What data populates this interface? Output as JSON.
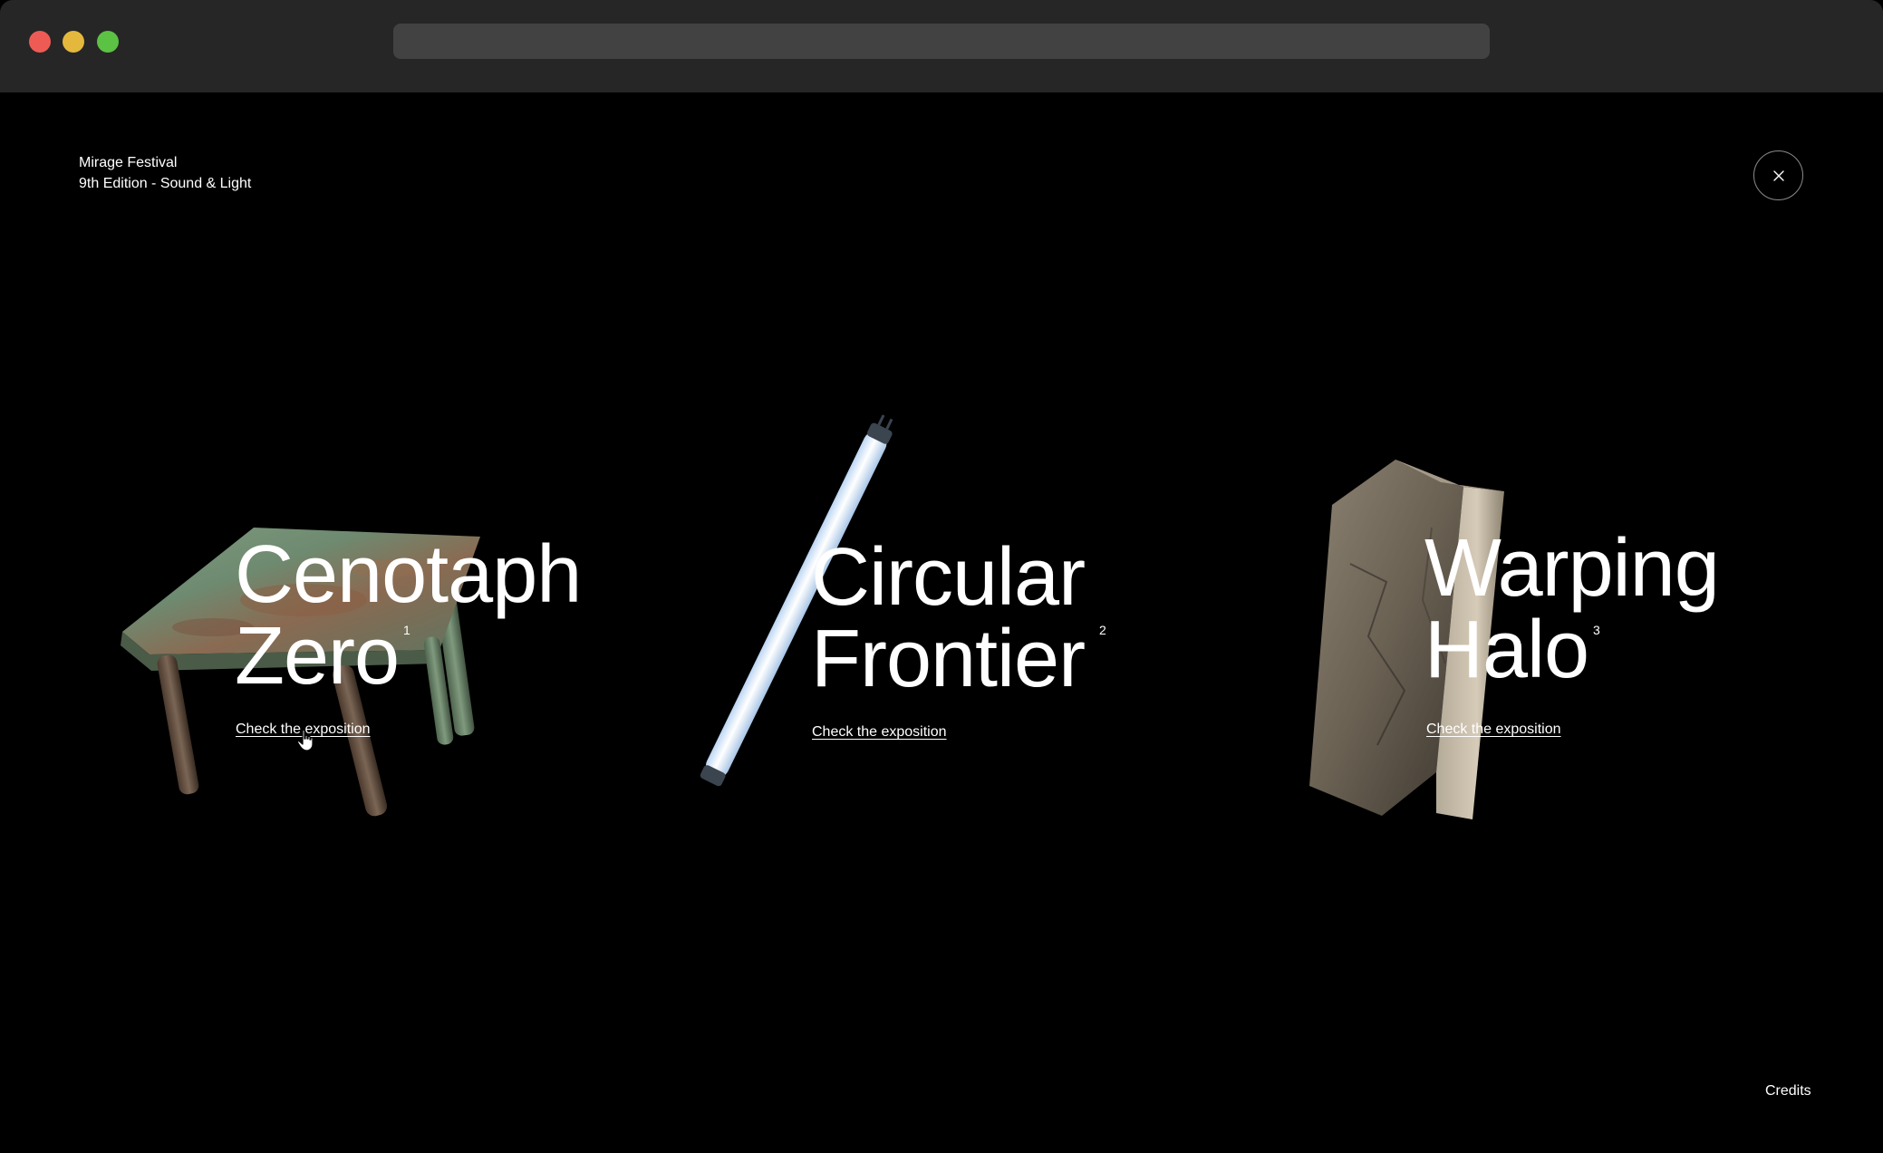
{
  "browser": {
    "url": ""
  },
  "header": {
    "brand_line1": "Mirage Festival",
    "brand_line2": "9th Edition - Sound & Light",
    "close_icon": "close-icon"
  },
  "exhibits": [
    {
      "title_line1": "Cenotaph",
      "title_line2": "Zero",
      "number": "1",
      "link": "Check the exposition",
      "object": "rusty-table"
    },
    {
      "title_line1": "Circular",
      "title_line2": "Frontier",
      "number": "2",
      "link": "Check the exposition",
      "object": "fluorescent-tube"
    },
    {
      "title_line1": "Warping",
      "title_line2": "Halo",
      "number": "3",
      "link": "Check the exposition",
      "object": "stone-block"
    }
  ],
  "footer": {
    "credits": "Credits"
  },
  "colors": {
    "background": "#000000",
    "titlebar": "#262626",
    "urlbar": "#424242",
    "text": "#ffffff"
  }
}
